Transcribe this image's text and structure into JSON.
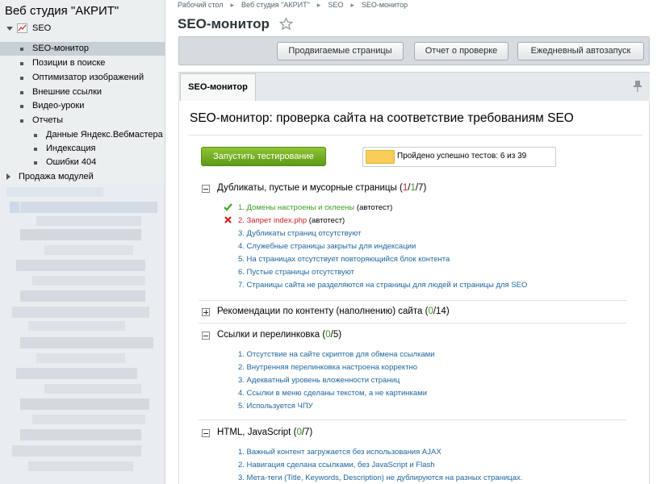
{
  "sidebar": {
    "site_title": "Веб студия \"АКРИТ\"",
    "seo_label": "SEO",
    "items": [
      {
        "label": "SEO-монитор"
      },
      {
        "label": "Позиции в поиске"
      },
      {
        "label": "Оптимизатор изображений"
      },
      {
        "label": "Внешние ссылки"
      },
      {
        "label": "Видео-уроки"
      },
      {
        "label": "Отчеты"
      }
    ],
    "report_items": [
      {
        "label": "Данные Яндекс.Вебмастера"
      },
      {
        "label": "Индексация"
      },
      {
        "label": "Ошибки 404"
      }
    ],
    "modules_label": "Продажа модулей"
  },
  "breadcrumb": [
    "Рабочий стол",
    "Веб студия \"АКРИТ\"",
    "SEO",
    "SEO-монитор"
  ],
  "page_title": "SEO-монитор",
  "toolbar": {
    "btn_pages": "Продвигаемые страницы",
    "btn_report": "Отчет о проверке",
    "btn_autorun": "Ежедневный автозапуск"
  },
  "tab": {
    "label": "SEO-монитор"
  },
  "content": {
    "title": "SEO-монитор: проверка сайта на соответствие требованиям SEO",
    "run_button": "Запустить тестирование",
    "progress_text": "Пройдено успешно тестов: 6 из 39",
    "progress_passed": 6,
    "progress_total": 39
  },
  "sections": [
    {
      "title": "Дубликаты, пустые и мусорные страницы",
      "count_open": "(",
      "count_red": "1",
      "count_sep1": "/",
      "count_green": "1",
      "count_rest": "/7)",
      "items": [
        "1. Домены настроены и склеены",
        "2. Запрет index.php",
        "3. Дубликаты страниц отсутствуют",
        "4. Служебные страницы закрыты для индексации",
        "5. На страницах отсутствует повторяющийся блок контента",
        "6. Пустые страницы отсутствуют",
        "7. Страницы сайта не разделяются на страницы для людей и страницы для SEO"
      ],
      "item1_suffix": " (автотест)",
      "item2_suffix": " (автотест)"
    },
    {
      "title": "Рекомендации по контенту (наполнению) сайта",
      "count_open": "(",
      "count_green": "0",
      "count_rest": "/14)"
    },
    {
      "title": "Ссылки и перелинковка",
      "count_open": "(",
      "count_green": "0",
      "count_rest": "/5)",
      "items": [
        "1. Отсутствие на сайте скриптов для обмена ссылками",
        "2. Внутренняя перелинковка настроена корректно",
        "3. Адекватный уровень вложенности страниц",
        "4. Ссылки в меню сделаны текстом, а не картинками",
        "5. Используется ЧПУ"
      ]
    },
    {
      "title": "HTML, JavaScript",
      "count_open": "(",
      "count_green": "0",
      "count_rest": "/7)",
      "items": [
        "1. Важный контент загружается без использования AJAX",
        "2. Навигация сделана ссылками, без JavaScript и Flash",
        "3. Мета-теги (Title, Keywords, Description) не дублируются на разных страницах."
      ]
    }
  ],
  "colors": {
    "accent_green": "#5d9a16",
    "link_blue": "#2066a0",
    "error_red": "#d02020",
    "progress_yellow": "#f7cd58"
  },
  "icons": {
    "star": "star-icon",
    "pin": "pin-icon",
    "check": "check-icon",
    "cross": "cross-icon",
    "seo": "seo-chart-icon"
  }
}
